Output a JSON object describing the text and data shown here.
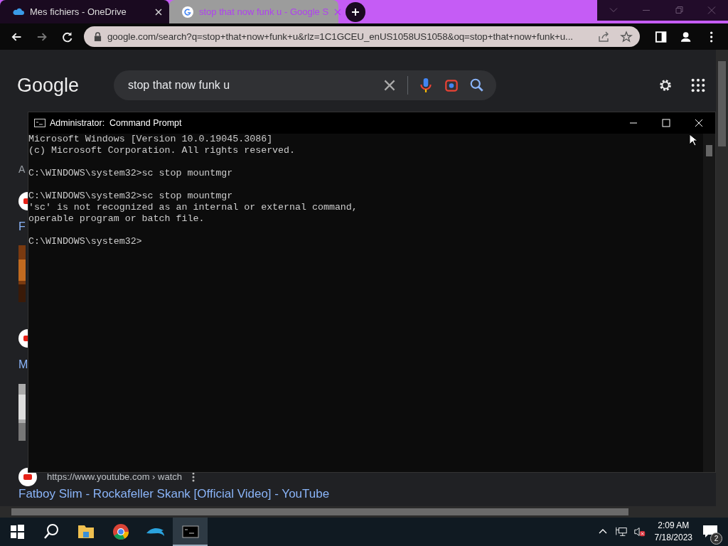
{
  "browser": {
    "tabs": [
      {
        "title": "Mes fichiers - OneDrive",
        "kind": "onedrive",
        "selected": false
      },
      {
        "title": "stop that now funk u - Google S",
        "kind": "google",
        "selected": true
      }
    ],
    "address": "google.com/search?q=stop+that+now+funk+u&rlz=1C1GCEU_enUS1058US1058&oq=stop+that+now+funk+u..."
  },
  "google": {
    "logo": "Google",
    "query": "stop that now funk u",
    "fragments": [
      {
        "text": "A",
        "kind": "label"
      },
      {
        "text": "F",
        "kind": "link"
      },
      {
        "text": "M",
        "kind": "link"
      }
    ],
    "result": {
      "url": "https://www.youtube.com › watch",
      "title": "Fatboy Slim - Rockafeller Skank [Official Video] - YouTube"
    }
  },
  "cmd": {
    "title": "Administrator:  Command Prompt",
    "blocks": [
      [
        "Microsoft Windows [Version 10.0.19045.3086]",
        "(c) Microsoft Corporation. All rights reserved."
      ],
      [
        "C:\\WINDOWS\\system32>sc stop mountmgr"
      ],
      [
        "C:\\WINDOWS\\system32>sc stop mountmgr",
        "'sc' is not recognized as an internal or external command,",
        "operable program or batch file."
      ],
      [
        "C:\\WINDOWS\\system32>"
      ]
    ]
  },
  "taskbar": {
    "apps": [
      {
        "kind": "explorer",
        "active": false
      },
      {
        "kind": "chrome",
        "active": false
      },
      {
        "kind": "dolphin",
        "active": false
      },
      {
        "kind": "terminal",
        "active": true
      }
    ],
    "time": "2:09 AM",
    "date": "7/18/2023",
    "notifications": "2"
  }
}
